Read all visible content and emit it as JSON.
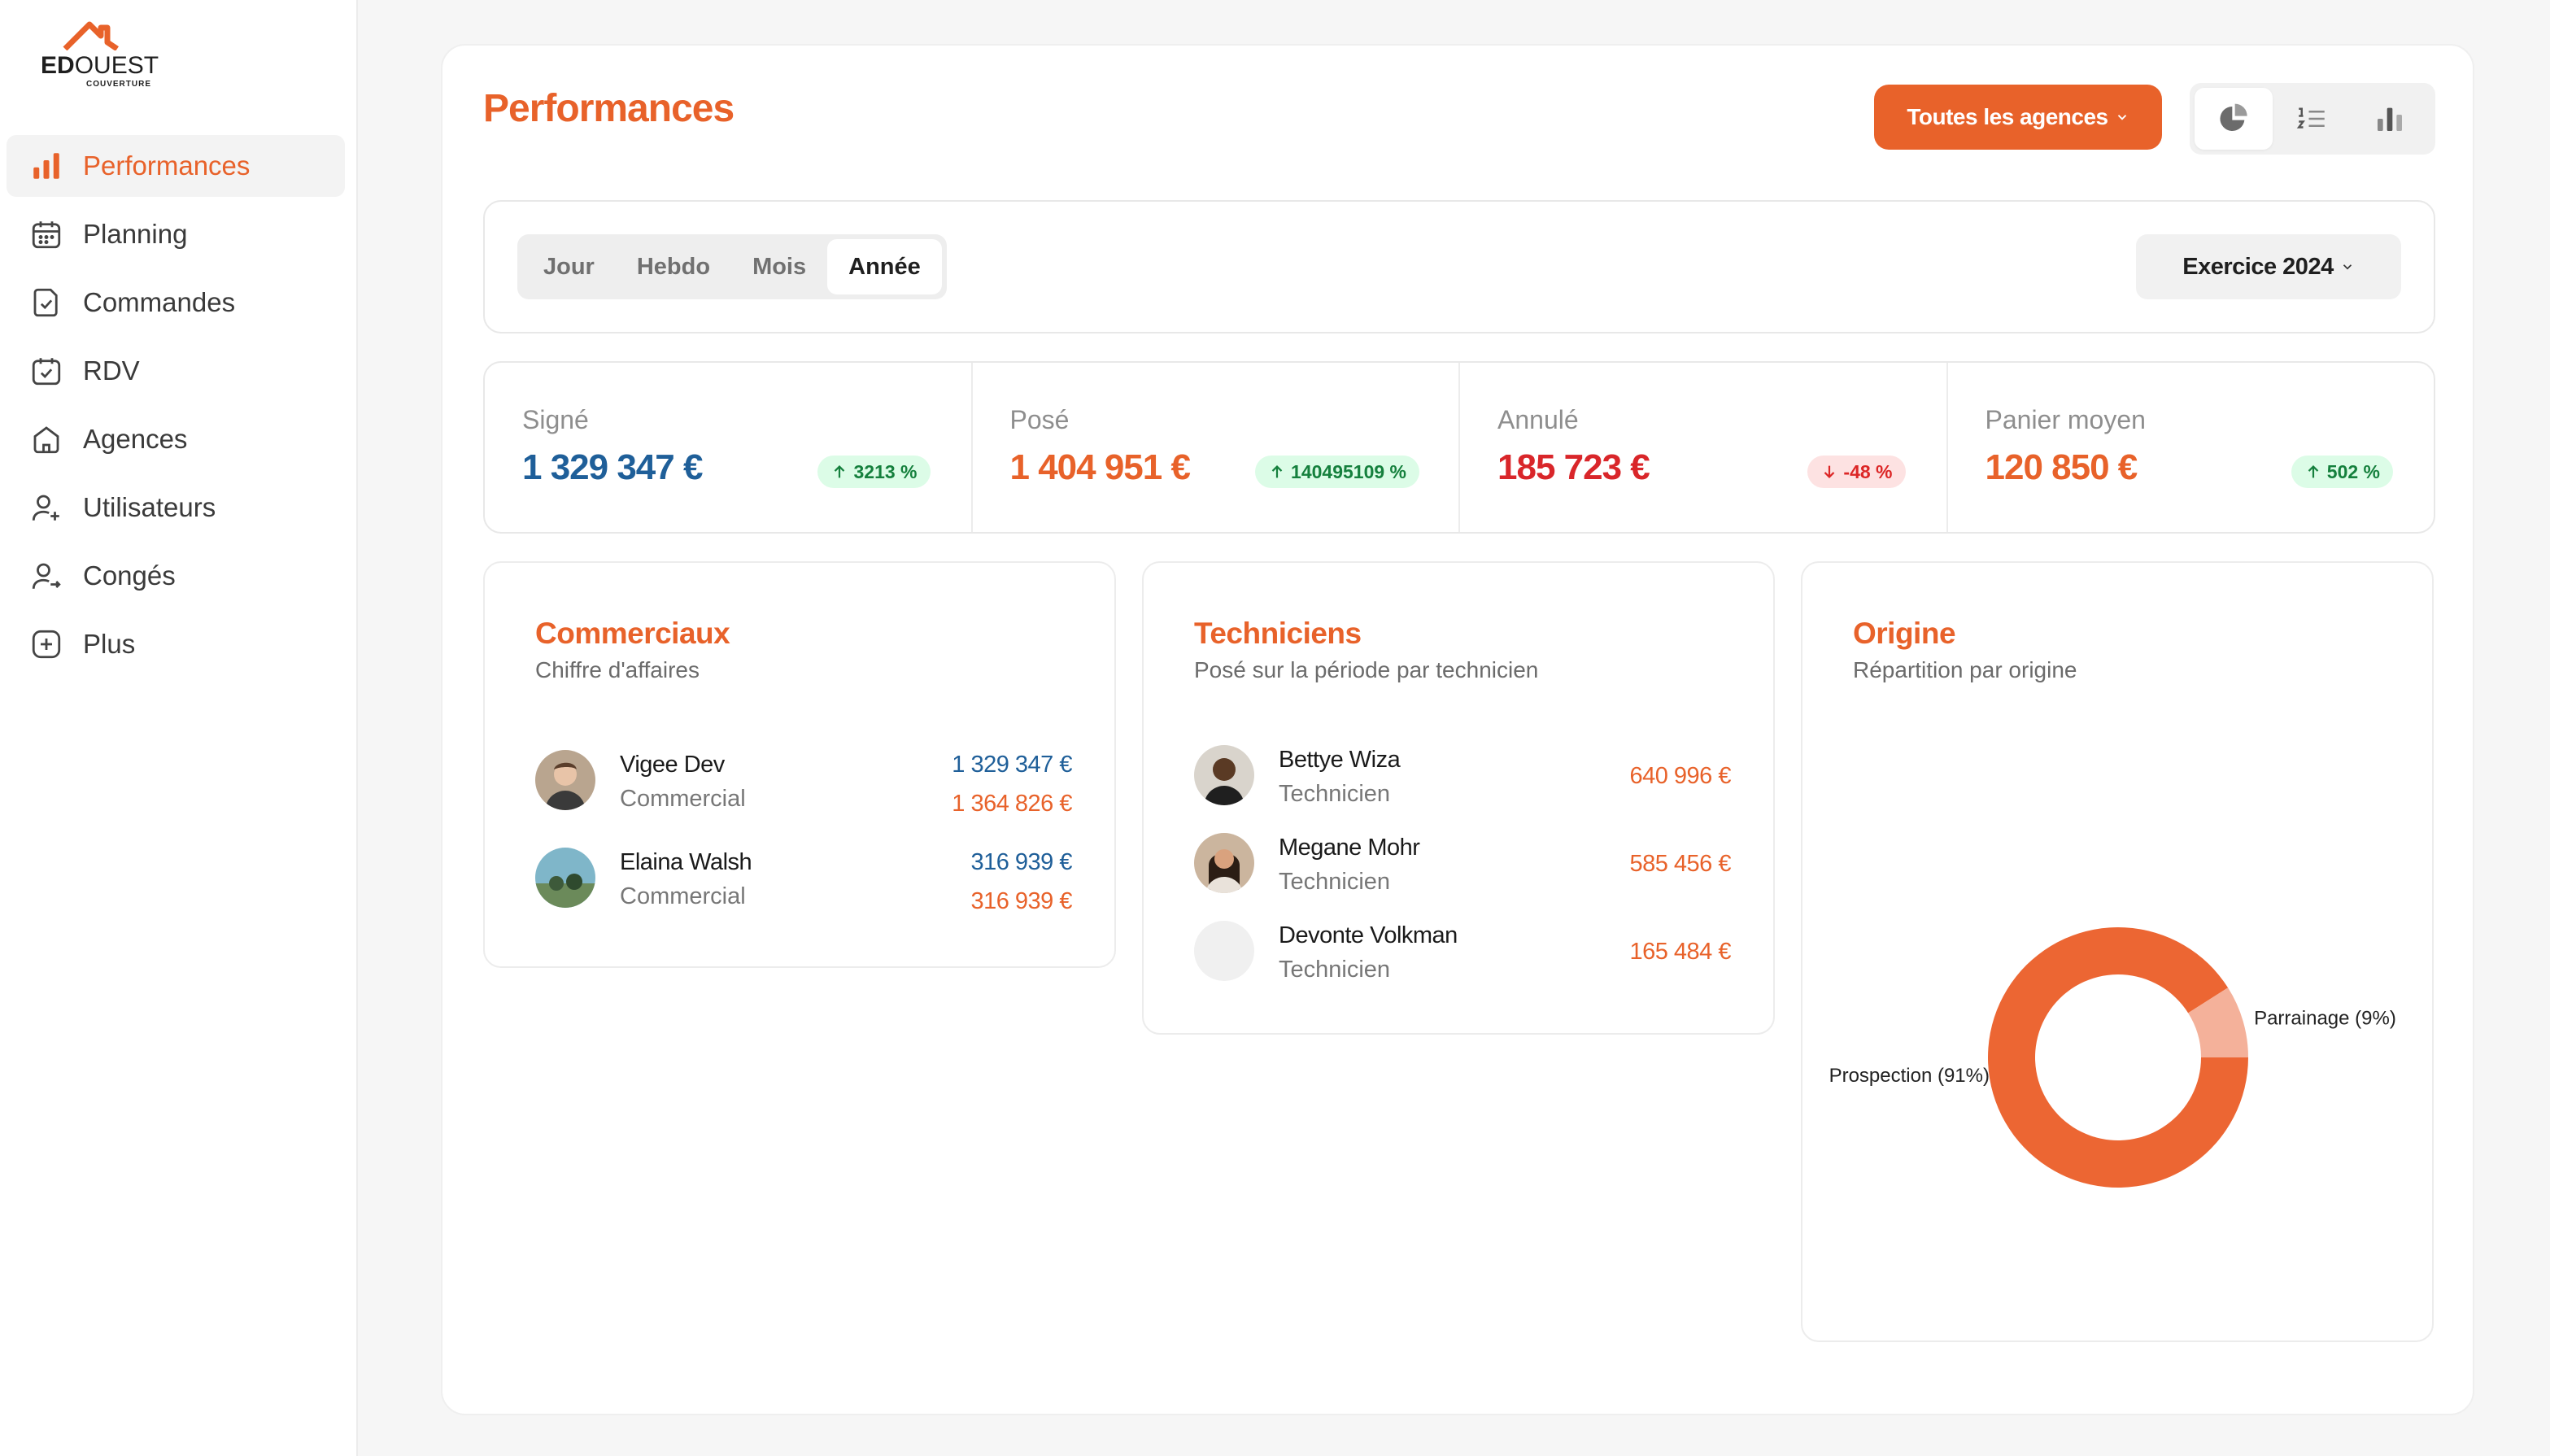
{
  "brand": {
    "name_bold": "ED",
    "name_rest": "OUEST",
    "sub": "COUVERTURE"
  },
  "sidebar": {
    "items": [
      {
        "label": "Performances",
        "icon": "bar-chart-icon",
        "active": true
      },
      {
        "label": "Planning",
        "icon": "calendar-icon"
      },
      {
        "label": "Commandes",
        "icon": "document-check-icon"
      },
      {
        "label": "RDV",
        "icon": "calendar-check-icon"
      },
      {
        "label": "Agences",
        "icon": "home-icon"
      },
      {
        "label": "Utilisateurs",
        "icon": "user-add-icon"
      },
      {
        "label": "Congés",
        "icon": "user-leave-icon"
      },
      {
        "label": "Plus",
        "icon": "plus-square-icon"
      }
    ]
  },
  "header": {
    "title": "Performances",
    "agency_button": "Toutes les agences",
    "views": [
      "pie-chart-icon",
      "ordered-list-icon",
      "bar-chart-icon"
    ]
  },
  "filters": {
    "periods": [
      "Jour",
      "Hebdo",
      "Mois",
      "Année"
    ],
    "active_period": "Année",
    "exercise": "Exercice 2024"
  },
  "kpis": [
    {
      "label": "Signé",
      "value": "1 329 347 €",
      "change": "3213 %",
      "trend": "up",
      "color": "#1f5f99"
    },
    {
      "label": "Posé",
      "value": "1 404 951 €",
      "change": "140495109 %",
      "trend": "up",
      "color": "#e8622a"
    },
    {
      "label": "Annulé",
      "value": "185 723 €",
      "change": "-48 %",
      "trend": "down",
      "color": "#d9262a"
    },
    {
      "label": "Panier moyen",
      "value": "120 850 €",
      "change": "502 %",
      "trend": "up",
      "color": "#e8622a"
    }
  ],
  "commerciaux": {
    "title": "Commerciaux",
    "subtitle": "Chiffre d'affaires",
    "rows": [
      {
        "name": "Vigee Dev",
        "role": "Commercial",
        "signed": "1 329 347 €",
        "posed": "1 364 826 €"
      },
      {
        "name": "Elaina Walsh",
        "role": "Commercial",
        "signed": "316 939 €",
        "posed": "316 939 €"
      }
    ]
  },
  "techniciens": {
    "title": "Techniciens",
    "subtitle": "Posé sur la période par technicien",
    "rows": [
      {
        "name": "Bettye Wiza",
        "role": "Technicien",
        "amount": "640 996 €"
      },
      {
        "name": "Megane Mohr",
        "role": "Technicien",
        "amount": "585 456 €"
      },
      {
        "name": "Devonte Volkman",
        "role": "Technicien",
        "amount": "165 484 €"
      }
    ]
  },
  "origine": {
    "title": "Origine",
    "subtitle": "Répartition par origine",
    "chart_data": {
      "type": "pie",
      "categories": [
        "Prospection",
        "Parrainage"
      ],
      "values": [
        91,
        9
      ],
      "labels": [
        "Prospection (91%)",
        "Parrainage (9%)"
      ],
      "colors": [
        "#ec6633",
        "#f4b19a"
      ]
    }
  },
  "colors": {
    "accent": "#e8622a",
    "blue": "#1f5f99",
    "red": "#d9262a"
  }
}
